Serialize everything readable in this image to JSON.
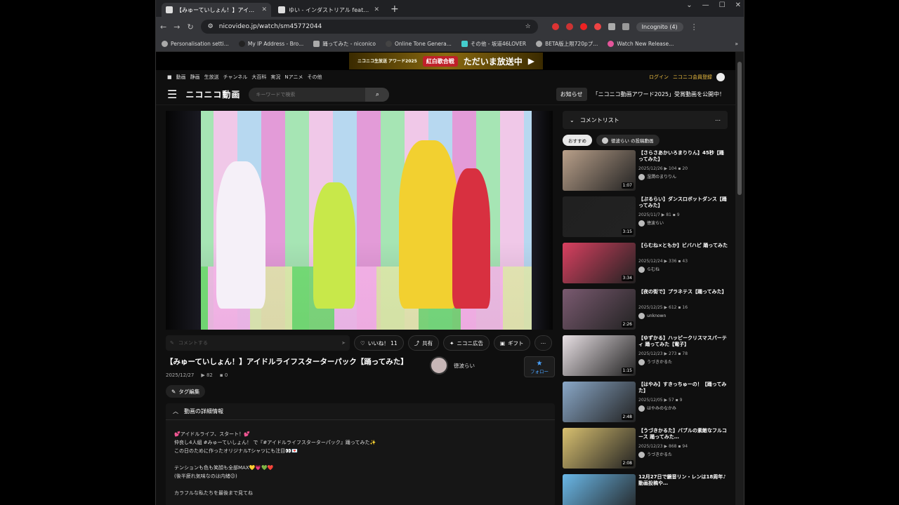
{
  "browser": {
    "tabs": [
      {
        "title": "【みゅーていしょん！】アイドルライフス",
        "active": true
      },
      {
        "title": "ゆい - インダストリアル feat. 初音ミ",
        "active": false
      }
    ],
    "url": "nicovideo.jp/watch/sm45772044",
    "incognito": "Incognito (4)",
    "bookmarks": [
      "Personalisation setti...",
      "My IP Address - Bro...",
      "踊ってみた - niconico",
      "Online Tone Genera...",
      "その他 - 坂道46LOVER",
      "BETA版上限720pプ...",
      "Watch New Release..."
    ]
  },
  "site": {
    "banner_text": "ただいま放送中",
    "banner_small": "ニコニコ生放送 アワード2025",
    "banner_pill": "紅白歌合戦",
    "topnav": [
      "動画",
      "静画",
      "生放送",
      "チャンネル",
      "大百科",
      "実況",
      "Nアニメ",
      "その他"
    ],
    "login": "ログイン",
    "register": "ニコニコ会員登録",
    "logo": "ニコニコ動画",
    "search_placeholder": "キーワードで検索",
    "notice_label": "お知らせ",
    "notice_text": "「ニコニコ動画アワード2025」受賞動画を公開中！"
  },
  "video": {
    "comment_placeholder": "コメントする",
    "like": "いいね！ 11",
    "share": "共有",
    "ad": "ニコニ広告",
    "gift": "ギフト",
    "title": "【みゅーていしょん！】アイドルライフスターターパック【踊ってみた】",
    "date": "2025/12/27",
    "views": "82",
    "comments": "0",
    "uploader": "徳波らい",
    "follow": "フォロー",
    "tag_edit": "タグ編集",
    "details_head": "動画の詳細情報",
    "description": "💕アイドルライフ、スタート！💕\n仲良し4人組 #みゅーていしょん！ で『#アイドルライフスターターパック』踊ってみた✨\nこの日のために作ったオリジナルTシャツにも注目👀💌\n\nテンションも色も笑顔も全部MAX💛💗💚❤️\n(後半疲れ気味なのは内緒😉)\n\nカラフルな私たちを最後まで見てね"
  },
  "sidebar": {
    "title": "コメントリスト",
    "chip_recommended": "おすすめ",
    "chip_uploader": "徳波らい の投稿動画",
    "items": [
      {
        "title": "【さらさあかいろまりりん】45秒【踊ってみた】",
        "date": "2025/12/26",
        "views": "104",
        "comments": "20",
        "user": "湿潤のまりりん",
        "duration": "1:07",
        "bg": "#b9a08a"
      },
      {
        "title": "【ぷるらい】ダンスロボットダンス【踊ってみた】",
        "date": "2025/11/7",
        "views": "81",
        "comments": "9",
        "user": "徳波らい",
        "duration": "3:15",
        "bg": "#202020"
      },
      {
        "title": "【らむね×ともか】ビバハピ 踊ってみた",
        "date": "2025/12/24",
        "views": "336",
        "comments": "43",
        "user": "らむね",
        "duration": "3:34",
        "bg": "#d94060"
      },
      {
        "title": "【夜の街で】プラネテス【踊ってみた】",
        "date": "2025/12/25",
        "views": "612",
        "comments": "16",
        "user": "unknown",
        "duration": "2:26",
        "bg": "#7a5a70"
      },
      {
        "title": "【ゆずかる】ハッピークリスマスパーティ 踊ってみた【電子】",
        "date": "2025/12/23",
        "views": "273",
        "comments": "78",
        "user": "うづきかるた",
        "duration": "1:15",
        "bg": "#e8e0e4"
      },
      {
        "title": "【はやみ】すきっちゅーの！【踊ってみた】",
        "date": "2025/12/05",
        "views": "57",
        "comments": "9",
        "user": "はやみのなかみ",
        "duration": "2:48",
        "bg": "#8aa8c8"
      },
      {
        "title": "【うづきかるた】バブルの素敵なフルコース 踊ってみた…",
        "date": "2025/12/23",
        "views": "868",
        "comments": "94",
        "user": "うづきかるた",
        "duration": "2:08",
        "bg": "#d8c070"
      },
      {
        "title": "12月27日で鏡音リン・レンは18周年♪動画投稿や…",
        "date": "",
        "views": "",
        "comments": "",
        "user": "",
        "duration": "",
        "bg": "#6ab8e8"
      }
    ]
  }
}
